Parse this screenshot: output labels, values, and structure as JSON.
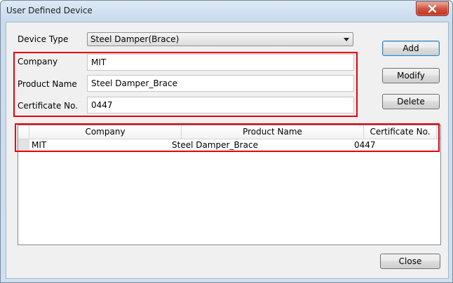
{
  "window": {
    "title": "User Defined Device"
  },
  "device_type": {
    "label": "Device Type",
    "value": "Steel Damper(Brace)"
  },
  "form": {
    "company": {
      "label": "Company",
      "value": "MIT"
    },
    "product_name": {
      "label": "Product Name",
      "value": "Steel Damper_Brace"
    },
    "certificate_no": {
      "label": "Certificate No.",
      "value": "0447"
    }
  },
  "buttons": {
    "add": "Add",
    "modify": "Modify",
    "delete": "Delete",
    "close": "Close"
  },
  "table": {
    "headers": [
      "Company",
      "Product Name",
      "Certificate No."
    ],
    "rows": [
      [
        "MIT",
        "Steel Damper_Brace",
        "0447"
      ]
    ]
  },
  "colors": {
    "highlight": "#e8000a"
  }
}
